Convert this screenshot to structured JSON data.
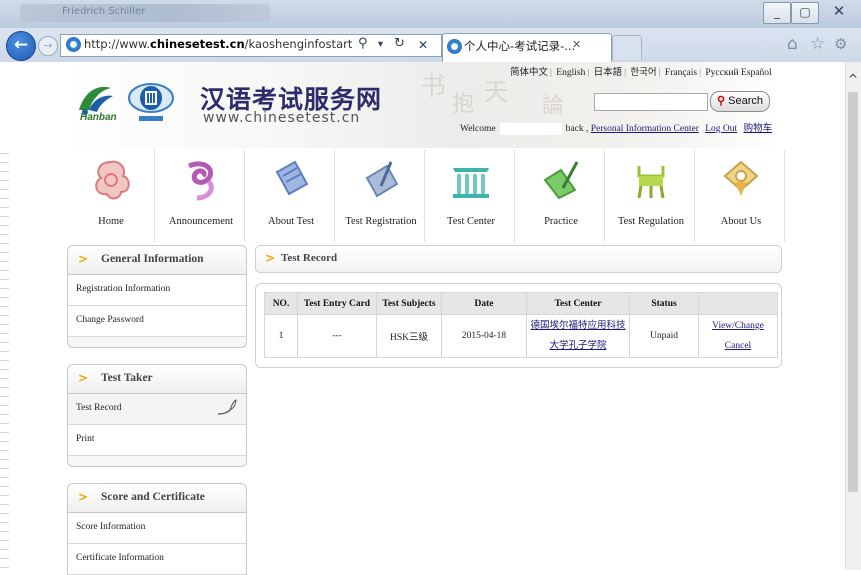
{
  "browser": {
    "window_title": "Friedrich Schiller",
    "address": "http://www.chinesetest.cn/kaoshenginfostartxiugaibyth",
    "address_host": "chinesetest.cn",
    "tab_title": "个人中心-考试记录-..."
  },
  "site": {
    "name": "汉语考试服务网",
    "url": "www.chinesetest.cn",
    "logo_text": "Hanban",
    "languages": [
      "简体中文",
      "English",
      "日本語",
      "한국어",
      "Français",
      "Русский",
      "Español"
    ],
    "search_label": "Search",
    "welcome": "Welcome",
    "back": "back",
    "personal_center": "Personal Information Center",
    "logout": "Log Out",
    "cart": "购物车"
  },
  "nav": [
    {
      "label": "Home",
      "icon": "home-icon"
    },
    {
      "label": "Announcement",
      "icon": "announcement-icon"
    },
    {
      "label": "About Test",
      "icon": "about-test-icon"
    },
    {
      "label": "Test Registration",
      "icon": "test-registration-icon"
    },
    {
      "label": "Test Center",
      "icon": "test-center-icon"
    },
    {
      "label": "Practice",
      "icon": "practice-icon"
    },
    {
      "label": "Test Regulation",
      "icon": "test-regulation-icon"
    },
    {
      "label": "About Us",
      "icon": "about-us-icon"
    }
  ],
  "sidebar": {
    "general": {
      "title": "General Information",
      "items": [
        "Registration Information",
        "Change Password"
      ]
    },
    "taker": {
      "title": "Test Taker",
      "items": [
        "Test Record",
        "Print"
      ]
    },
    "score": {
      "title": "Score and Certificate",
      "items": [
        "Score Information",
        "Certificate Information"
      ]
    }
  },
  "main": {
    "title": "Test Record",
    "columns": [
      "NO.",
      "Test Entry Card",
      "Test Subjects",
      "Date",
      "Test Center",
      "Status",
      ""
    ],
    "row": {
      "no": "1",
      "entry_card": "---",
      "subject": "HSK三级",
      "date": "2015-04-18",
      "center_line1": "德国埃尔福特应用科技",
      "center_line2": "大学孔子学院",
      "status": "Unpaid",
      "action1": "View/Change",
      "action2": "Cancel"
    }
  },
  "colors": {
    "accent_arrow": "#f0a800",
    "link": "#1a1a7a",
    "site_name": "#2d2d6e"
  }
}
